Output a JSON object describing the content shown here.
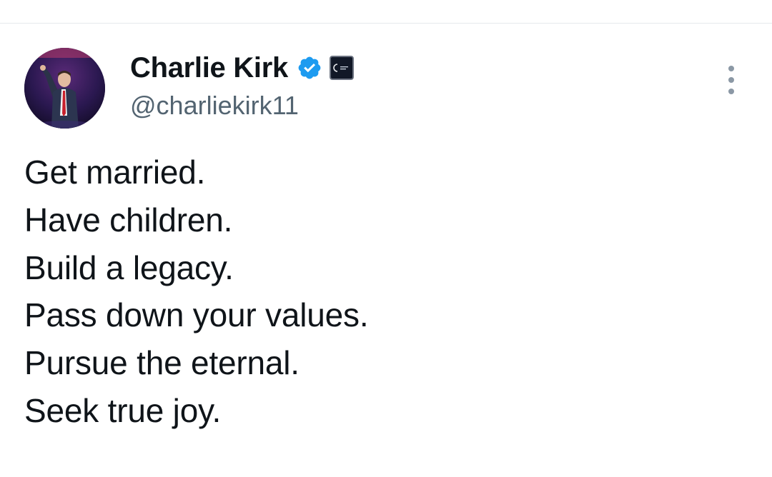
{
  "tweet": {
    "author": {
      "display_name": "Charlie Kirk",
      "handle": "@charliekirk11",
      "verified_icon": "verified-badge-icon",
      "affiliate_icon": "affiliate-org-badge-icon",
      "avatar_icon": "profile-photo"
    },
    "more_icon": "more-options-icon",
    "lines": [
      "Get married.",
      "Have children.",
      "Build a legacy.",
      "Pass down your values.",
      "Pursue the eternal.",
      "Seek true joy."
    ]
  },
  "colors": {
    "text_primary": "#0f1419",
    "text_secondary": "#536471",
    "verified_blue": "#1d9bf0",
    "divider": "#e6e9ec"
  }
}
